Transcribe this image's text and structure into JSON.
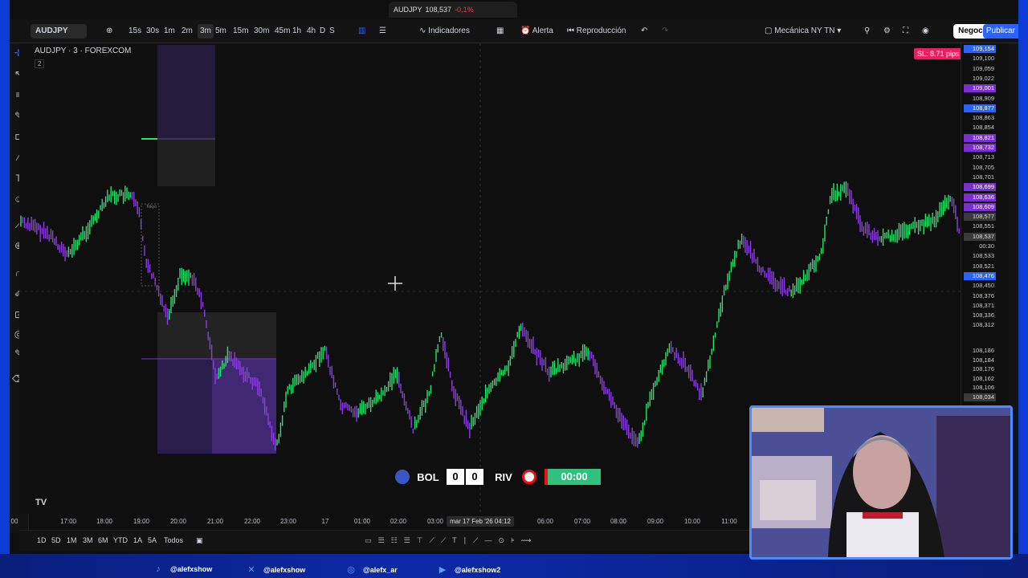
{
  "browser_tab": {
    "symbol": "AUDJPY",
    "price": "108,537",
    "change": "-0,1%"
  },
  "toolbar": {
    "symbol": "AUDJPY",
    "intervals": [
      "15s",
      "30s",
      "1m",
      "2m",
      "3m",
      "5m",
      "15m",
      "30m",
      "45m",
      "1h",
      "4h",
      "D",
      "S"
    ],
    "active_interval": "3m",
    "indicators_label": "Indicadores",
    "alert_label": "Alerta",
    "replay_label": "Reproducción",
    "layout_name": "Mecánica NY TN",
    "trade_label": "Negocie",
    "publish_label": "Publicar"
  },
  "legend": {
    "title": "AUDJPY · 3 · FOREXCOM",
    "count": "2"
  },
  "sl_badge": "SL: 8.71 pips",
  "price_axis": [
    {
      "v": "109,154",
      "c": "blue"
    },
    {
      "v": "109,100",
      "c": ""
    },
    {
      "v": "109,059",
      "c": ""
    },
    {
      "v": "109,022",
      "c": ""
    },
    {
      "v": "109,001",
      "c": "purple"
    },
    {
      "v": "108,909",
      "c": ""
    },
    {
      "v": "108,877",
      "c": "blue"
    },
    {
      "v": "108,863",
      "c": ""
    },
    {
      "v": "108,854",
      "c": ""
    },
    {
      "v": "108,821",
      "c": "purple"
    },
    {
      "v": "108,732",
      "c": "purple"
    },
    {
      "v": "108,713",
      "c": ""
    },
    {
      "v": "108,705",
      "c": ""
    },
    {
      "v": "108,701",
      "c": ""
    },
    {
      "v": "108,699",
      "c": "purple"
    },
    {
      "v": "108,636",
      "c": "purple"
    },
    {
      "v": "108,609",
      "c": "purple"
    },
    {
      "v": "108,577",
      "c": "gray"
    },
    {
      "v": "108,551",
      "c": ""
    },
    {
      "v": "108,537",
      "c": "gray"
    },
    {
      "v": "00:30",
      "c": ""
    },
    {
      "v": "108,533",
      "c": ""
    },
    {
      "v": "108,521",
      "c": ""
    },
    {
      "v": "108,476",
      "c": "blue"
    },
    {
      "v": "108,450",
      "c": ""
    },
    {
      "v": "108,376",
      "c": ""
    },
    {
      "v": "108,371",
      "c": ""
    },
    {
      "v": "108,336",
      "c": ""
    },
    {
      "v": "108,312",
      "c": ""
    },
    {
      "v": "108,186",
      "c": ""
    },
    {
      "v": "108,184",
      "c": ""
    },
    {
      "v": "108,176",
      "c": ""
    },
    {
      "v": "108,162",
      "c": ""
    },
    {
      "v": "108,106",
      "c": ""
    },
    {
      "v": "108,034",
      "c": "gray"
    }
  ],
  "time_axis": [
    "00",
    "17:00",
    "18:00",
    "19:00",
    "20:00",
    "21:00",
    "22:00",
    "23:00",
    "17",
    "01:00",
    "02:00",
    "03:00",
    "06:00",
    "07:00",
    "08:00",
    "09:00",
    "10:00",
    "11:00"
  ],
  "current_time": "mar 17 Feb '26  04:12",
  "bottom_ranges": [
    "1D",
    "5D",
    "1M",
    "3M",
    "6M",
    "YTD",
    "1A",
    "5A",
    "Todos"
  ],
  "session_label": "Tokyo",
  "scoreboard": {
    "home": "BOL",
    "home_score": "0",
    "away_score": "0",
    "away": "RIV",
    "clock": "00:00"
  },
  "social": [
    {
      "icon": "tiktok-icon",
      "handle": "@alefxshow"
    },
    {
      "icon": "x-icon",
      "handle": "@alefxshow"
    },
    {
      "icon": "instagram-icon",
      "handle": "@alefx_ar"
    },
    {
      "icon": "youtube-icon",
      "handle": "@alefxshow2"
    }
  ],
  "colors": {
    "up": "#26e36a",
    "down": "#8a3de0",
    "zone": "#7b2fd0",
    "accent": "#2962ff",
    "sl": "#e91e63"
  }
}
